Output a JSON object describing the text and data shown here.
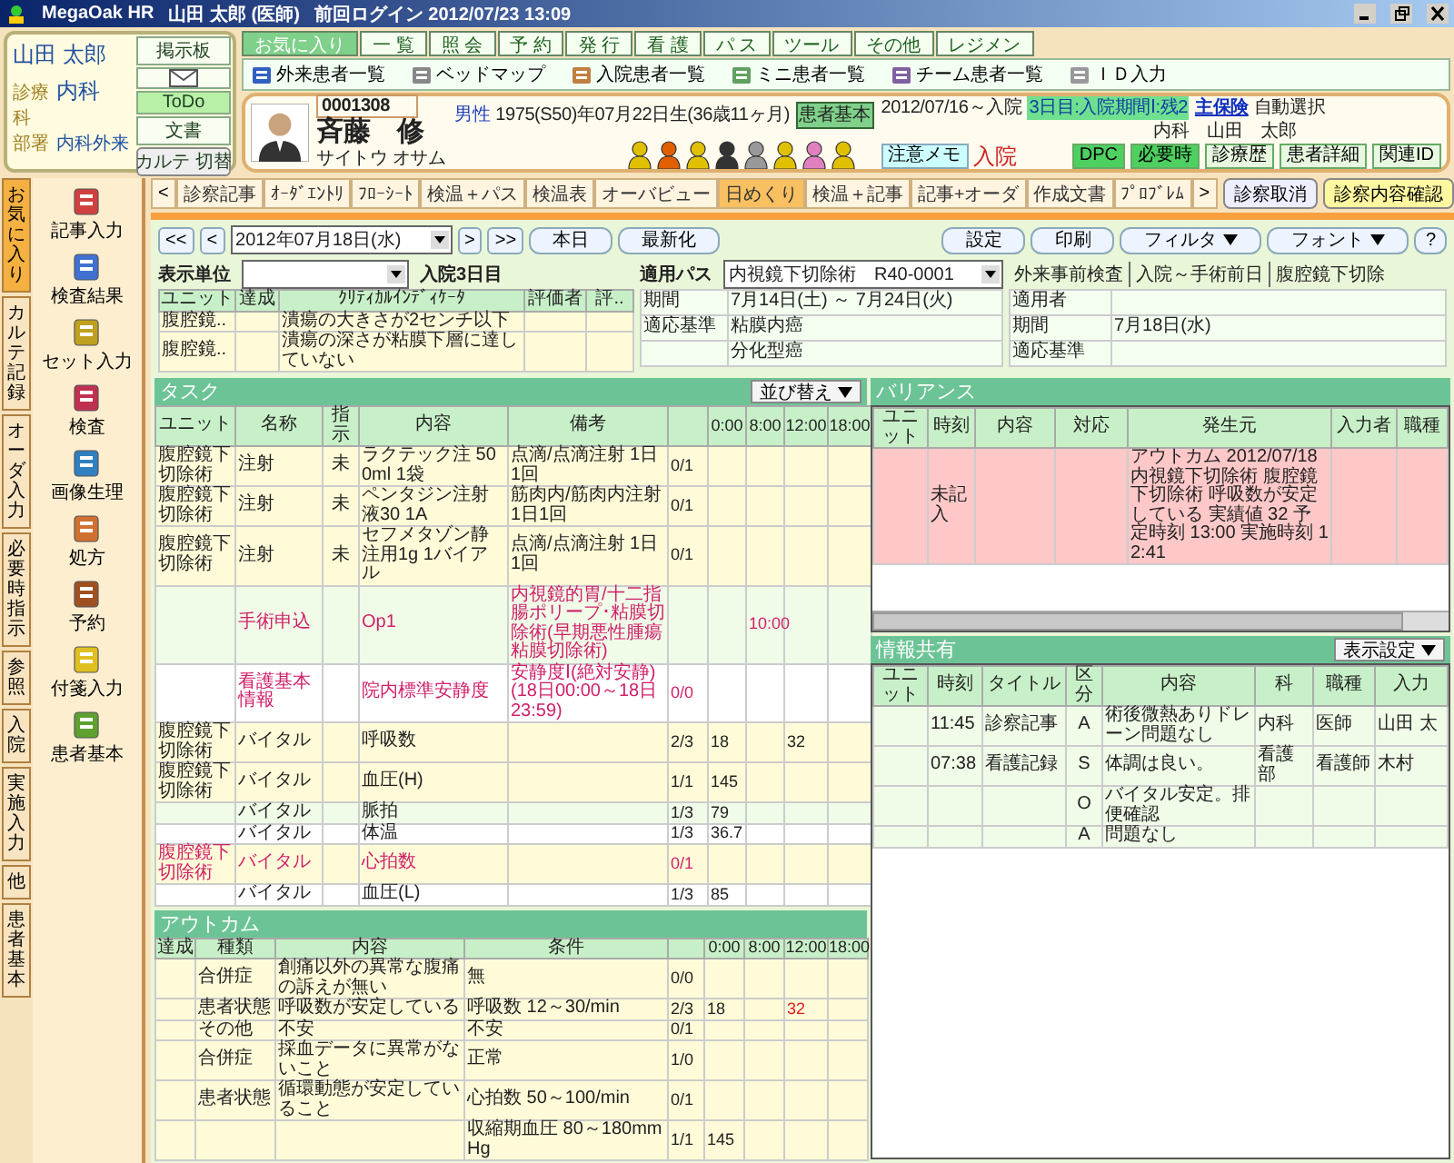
{
  "title_bar": {
    "app": "MegaOak HR",
    "user": "山田 太郎 (医師)",
    "last_login": "前回ログイン 2012/07/23 13:09"
  },
  "user_panel": {
    "name": "山田 太郎",
    "fields": [
      {
        "label": "診療科",
        "value": "内科"
      },
      {
        "label": "部署",
        "value": "内科外来"
      }
    ],
    "buttons": [
      {
        "kind": "text",
        "label": "掲示板",
        "selected": false
      },
      {
        "kind": "mail",
        "selected": false
      },
      {
        "kind": "text",
        "label": "ToDo",
        "selected": true
      },
      {
        "kind": "text",
        "label": "文書",
        "selected": false
      }
    ],
    "switch_button": "カルテ 切替"
  },
  "menu_tabs": [
    {
      "label": "お気に入り",
      "selected": true
    },
    {
      "label": "一 覧",
      "selected": false
    },
    {
      "label": "照 会",
      "selected": false
    },
    {
      "label": "予 約",
      "selected": false
    },
    {
      "label": "発 行",
      "selected": false
    },
    {
      "label": "看 護",
      "selected": false
    },
    {
      "label": "パ ス",
      "selected": false
    },
    {
      "label": "ツール",
      "selected": false
    },
    {
      "label": "その他",
      "selected": false
    },
    {
      "label": "レジメン",
      "selected": false
    }
  ],
  "toolbar": [
    "外来患者一覧",
    "ベッドマップ",
    "入院患者一覧",
    "ミニ患者一覧",
    "チーム患者一覧",
    "ＩＤ入力"
  ],
  "patient": {
    "id": "0001308",
    "name": "斉藤　修",
    "kana": "サイトウ オサム",
    "sex": "男性",
    "birth": "1975(S50)年07月22日生(36歳11ヶ月)",
    "basic_badge": "患者基本",
    "admission": "2012/07/16～入院",
    "stay": "3日目:入院期間Ⅰ:残2",
    "insurance_link": "主保険",
    "insurance": "自動選択",
    "doctor": "内科　山田　太郎",
    "memo_button": "注意メモ",
    "status": "入院",
    "buttons": [
      {
        "label": "DPC",
        "highlight": true
      },
      {
        "label": "必要時",
        "highlight": true
      },
      {
        "label": "診療歴",
        "highlight": false
      },
      {
        "label": "患者詳細",
        "highlight": false
      },
      {
        "label": "関連ID",
        "highlight": false
      }
    ]
  },
  "view_tabs": [
    {
      "label": "診察記事",
      "selected": false
    },
    {
      "label": "ｵｰﾀﾞｴﾝﾄﾘ",
      "selected": false
    },
    {
      "label": "ﾌﾛｰｼｰﾄ",
      "selected": false
    },
    {
      "label": "検温＋パス",
      "selected": false
    },
    {
      "label": "検温表",
      "selected": false
    },
    {
      "label": "オーバビュー",
      "selected": false
    },
    {
      "label": "日めくり",
      "selected": true
    },
    {
      "label": "検温＋記事",
      "selected": false
    },
    {
      "label": "記事+オーダ",
      "selected": false
    },
    {
      "label": "作成文書",
      "selected": false
    },
    {
      "label": "ﾌﾟﾛﾌﾞﾚﾑ",
      "selected": false
    }
  ],
  "tab_scroll": [
    "<",
    ">"
  ],
  "actions": [
    {
      "label": "診察取消",
      "primary": false
    },
    {
      "label": "診察内容確認",
      "primary": true
    }
  ],
  "left_tabs": [
    {
      "label": "お気に入り",
      "selected": true
    },
    {
      "label": "カルテ記録",
      "selected": false
    },
    {
      "label": "オーダ入力",
      "selected": false
    },
    {
      "label": "必要時指示",
      "selected": false
    },
    {
      "label": "参照",
      "selected": false
    },
    {
      "label": "入院",
      "selected": false
    },
    {
      "label": "実施入力",
      "selected": false
    },
    {
      "label": "他",
      "selected": false
    },
    {
      "label": "患者基本",
      "selected": false
    }
  ],
  "tools": [
    "記事入力",
    "検査結果",
    "セット入力",
    "検査",
    "画像生理",
    "処方",
    "予約",
    "付箋入力",
    "患者基本"
  ],
  "date_bar": {
    "nav": [
      "<<",
      "<"
    ],
    "date": "2012年07月18日(水)",
    "nav_after": [
      ">",
      ">>"
    ],
    "buttons": [
      "本日",
      "最新化"
    ],
    "right_buttons": [
      {
        "label": "設定",
        "menu": false
      },
      {
        "label": "印刷",
        "menu": false
      },
      {
        "label": "フィルタ",
        "menu": true
      },
      {
        "label": "フォント",
        "menu": true
      },
      {
        "label": "?",
        "menu": false
      }
    ]
  },
  "display_unit": {
    "label": "表示単位",
    "day": "入院3日目"
  },
  "indicators": {
    "columns": [
      "ユニット",
      "達成",
      "ｸﾘﾃｨｶﾙｲﾝﾃﾞｨｹｰﾀ",
      "評価者",
      "評.."
    ],
    "rows": [
      {
        "unit": "腹腔鏡..",
        "indicator": "潰瘍の大きさが2センチ以下"
      },
      {
        "unit": "腹腔鏡..",
        "indicator": "潰瘍の深さが粘膜下層に達していない"
      }
    ]
  },
  "path": {
    "label": "適用パス",
    "value": "内視鏡下切除術　R40-0001",
    "rows": [
      {
        "label": "期間",
        "value": "7月14日(土) ～ 7月24日(火)"
      },
      {
        "label": "適応基準",
        "value": "粘膜内癌"
      },
      {
        "value": "分化型癌"
      }
    ]
  },
  "path_stage": {
    "tabs": [
      "外来事前検査",
      "入院～手術前日",
      "腹腔鏡下切除"
    ],
    "rows": [
      {
        "label": "適用者"
      },
      {
        "label": "期間",
        "value": "7月18日(水)"
      },
      {
        "label": "適応基準"
      }
    ]
  },
  "tasks": {
    "title": "タスク",
    "sort_button": "並び替え",
    "columns": [
      "ユニット",
      "名称",
      "指示",
      "内容",
      "備考"
    ],
    "time_columns": [
      "0:00",
      "8:00",
      "12:00",
      "18:00"
    ],
    "rows": [
      {
        "kind": "order",
        "alert": false,
        "unit": "腹腔鏡下切除術",
        "name": "注射",
        "order": "未",
        "content": "ラクテック注 500ml 1袋",
        "note": "点滴/点滴注射 1日1回",
        "count": "0/1"
      },
      {
        "kind": "order",
        "alert": false,
        "unit": "腹腔鏡下切除術",
        "name": "注射",
        "order": "未",
        "content": "ペンタジン注射液30 1A",
        "note": "筋肉内/筋肉内注射 1日1回",
        "count": "0/1"
      },
      {
        "kind": "order",
        "alert": false,
        "unit": "腹腔鏡下切除術",
        "name": "注射",
        "order": "未",
        "content": "セフメタゾン静注用1g 1バイアル",
        "note": "点滴/点滴注射 1日1回",
        "count": "0/1"
      },
      {
        "kind": "procedure",
        "alert": true,
        "name": "手術申込",
        "content": "Op1",
        "note": "内視鏡的胃/十二指腸ポリープ･粘膜切除術(早期悪性腫瘍粘膜切除術)",
        "times": {
          "8:00": "10:00"
        }
      },
      {
        "kind": "nursing",
        "alert": true,
        "name": "看護基本情報",
        "content": "院内標準安静度",
        "note": "安静度Ⅰ(絶対安静)(18日00:00～18日23:59)",
        "count": "0/0"
      },
      {
        "kind": "order",
        "alert": false,
        "unit": "腹腔鏡下切除術",
        "name": "バイタル",
        "content": "呼吸数",
        "count": "2/3",
        "times": {
          "0:00": "18",
          "12:00": "32"
        }
      },
      {
        "kind": "order",
        "alert": false,
        "unit": "腹腔鏡下切除術",
        "name": "バイタル",
        "content": "血圧(H)",
        "count": "1/1",
        "times": {
          "0:00": "145"
        }
      },
      {
        "kind": "procedure",
        "alert": false,
        "name": "バイタル",
        "content": "脈拍",
        "count": "1/3",
        "times": {
          "0:00": "79"
        }
      },
      {
        "kind": "nursing",
        "alert": false,
        "name": "バイタル",
        "content": "体温",
        "count": "1/3",
        "times": {
          "0:00": "36.7"
        }
      },
      {
        "kind": "order",
        "alert": true,
        "unit": "腹腔鏡下切除術",
        "name": "バイタル",
        "content": "心拍数",
        "count": "0/1"
      },
      {
        "kind": "nursing",
        "alert": false,
        "name": "バイタル",
        "content": "血圧(L)",
        "count": "1/3",
        "times": {
          "0:00": "85"
        }
      }
    ]
  },
  "outcomes": {
    "title": "アウトカム",
    "columns": [
      "達成",
      "種類",
      "内容",
      "条件"
    ],
    "time_columns": [
      "0:00",
      "8:00",
      "12:00",
      "18:00"
    ],
    "rows": [
      {
        "type": "合併症",
        "content": "創痛以外の異常な腹痛の訴えが無い",
        "condition": "無",
        "count": "0/0"
      },
      {
        "type": "患者状態",
        "content": "呼吸数が安定している",
        "condition": "呼吸数 12～30/min",
        "count": "2/3",
        "times": {
          "0:00": {
            "value": "18",
            "alert": false
          },
          "12:00": {
            "value": "32",
            "alert": true
          }
        }
      },
      {
        "type": "その他",
        "content": "不安",
        "condition": "不安",
        "count": "0/1"
      },
      {
        "type": "合併症",
        "content": "採血データに異常がないこと",
        "condition": "正常",
        "count": "1/0"
      },
      {
        "type": "患者状態",
        "content": "循環動態が安定していること",
        "condition": "心拍数 50～100/min",
        "count": "0/1"
      },
      {
        "condition": "収縮期血圧 80～180mmHg",
        "count": "1/1",
        "times": {
          "0:00": {
            "value": "145",
            "alert": false
          }
        }
      }
    ]
  },
  "variance": {
    "title": "バリアンス",
    "columns": [
      "ユニット",
      "時刻",
      "内容",
      "対応",
      "発生元",
      "入力者",
      "職種"
    ],
    "rows": [
      {
        "unrecorded": true,
        "time": "未記入",
        "source": "アウトカム 2012/07/18 内視鏡下切除術 腹腔鏡下切除術 呼吸数が安定している 実績値 32 予定時刻 13:00 実施時刻 12:41"
      }
    ]
  },
  "info_share": {
    "title": "情報共有",
    "settings_button": "表示設定",
    "columns": [
      "ユニット",
      "時刻",
      "タイトル",
      "区分",
      "内容",
      "科",
      "職種",
      "入力"
    ],
    "rows": [
      {
        "time": "11:45",
        "title": "診察記事",
        "category": "A",
        "content": "術後微熱ありドレーン問題なし",
        "dept": "内科",
        "role": "医師",
        "author": "山田 太"
      },
      {
        "time": "07:38",
        "title": "看護記録",
        "category": "S",
        "content": "体調は良い。",
        "dept": "看護部",
        "role": "看護師",
        "author": "木村"
      },
      {
        "category": "O",
        "content": "バイタル安定。排便確認"
      },
      {
        "category": "A",
        "content": "問題なし"
      }
    ]
  }
}
